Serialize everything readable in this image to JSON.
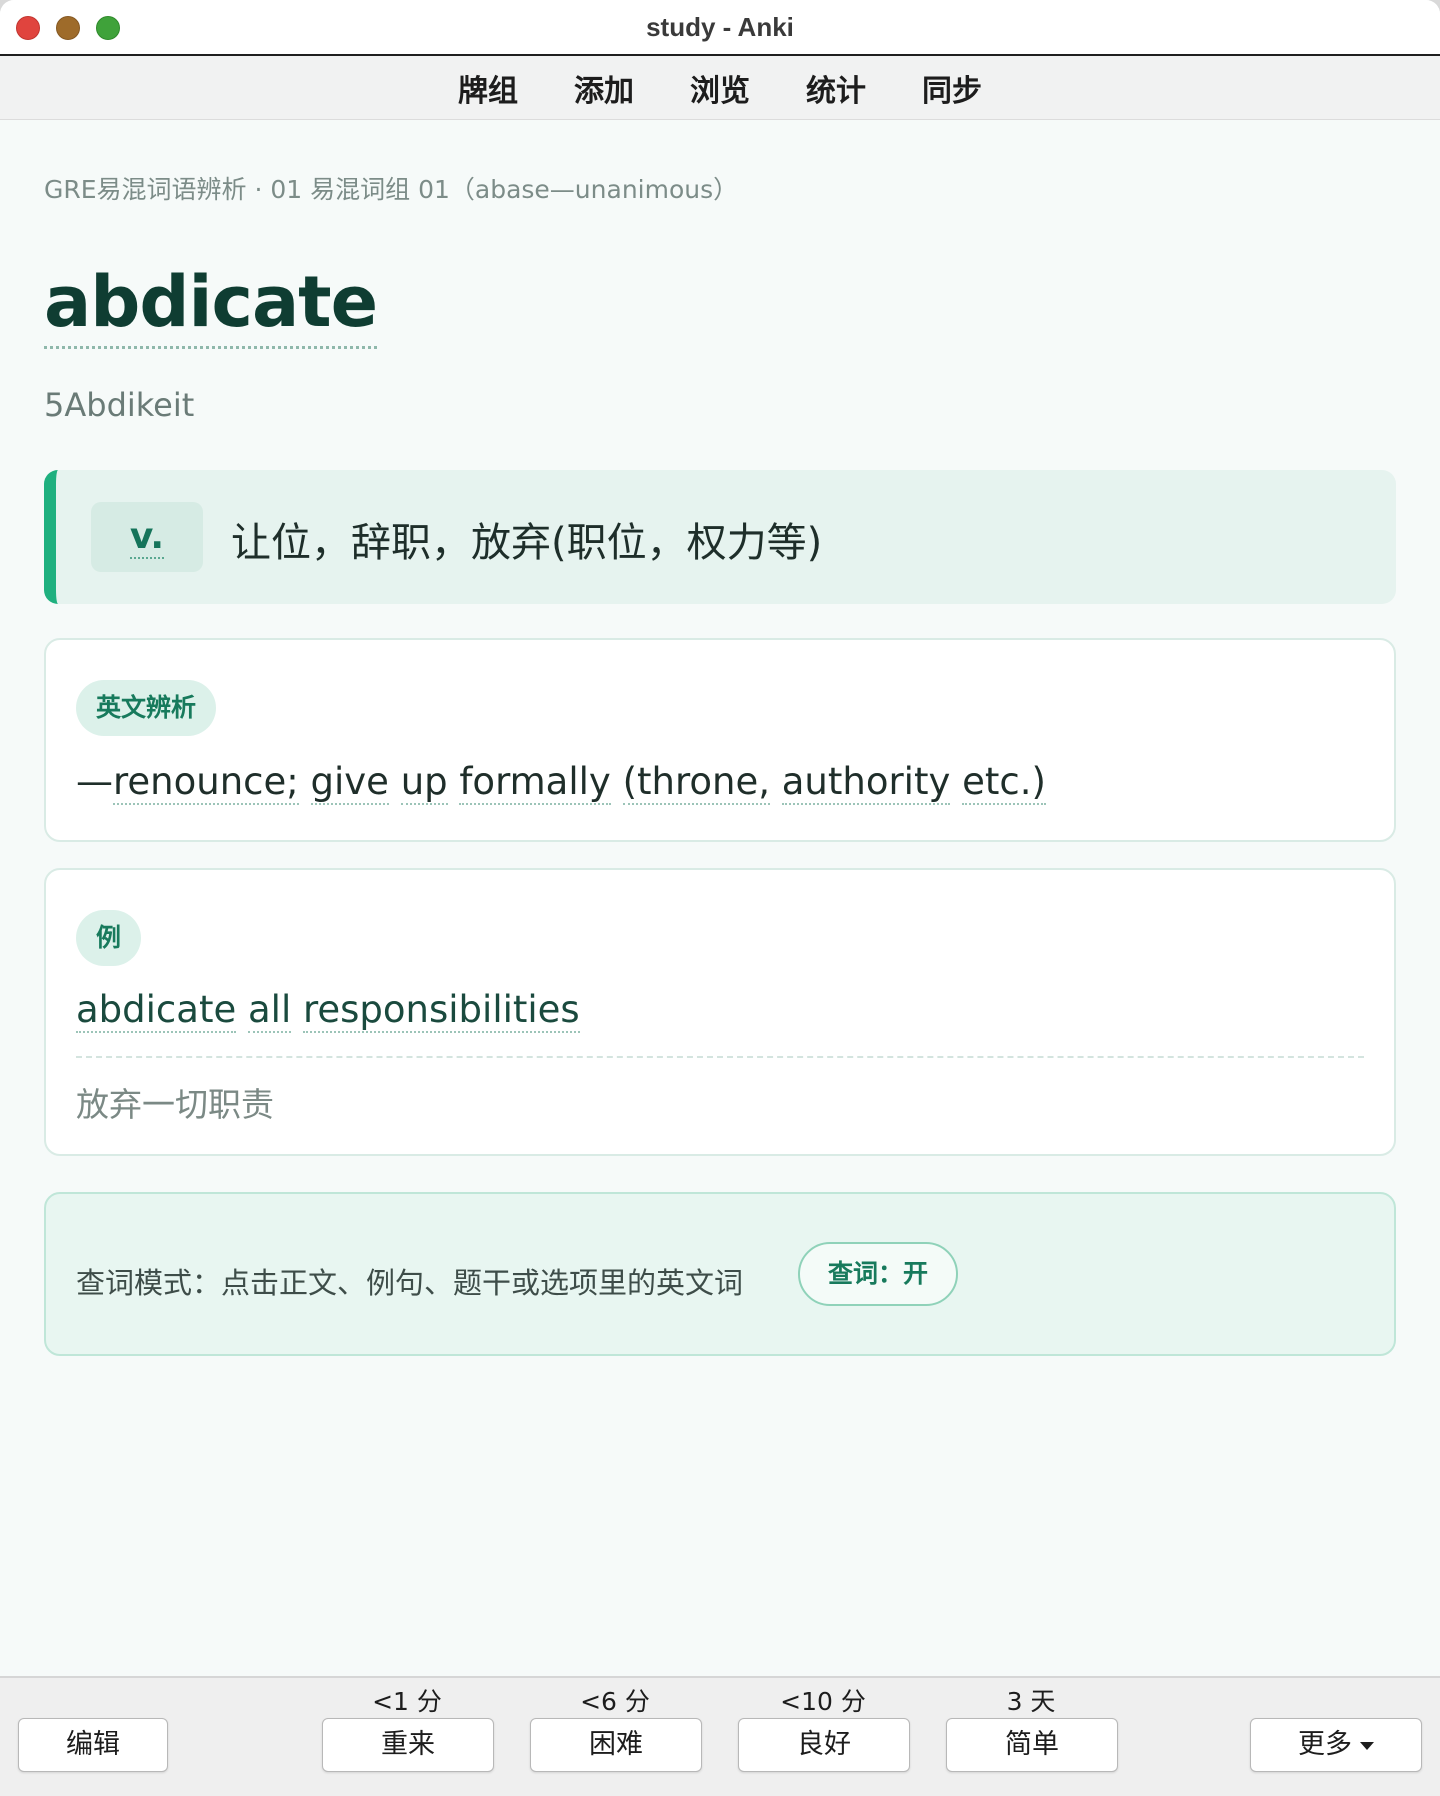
{
  "window": {
    "title": "study - Anki"
  },
  "toolbar": {
    "items": [
      {
        "label": "牌组"
      },
      {
        "label": "添加"
      },
      {
        "label": "浏览"
      },
      {
        "label": "统计"
      },
      {
        "label": "同步"
      }
    ]
  },
  "card": {
    "deck_path": "GRE易混词语辨析 · 01 易混词组 01（abase—unanimous）",
    "headword": "abdicate",
    "phonetic": "5Abdikeit",
    "part_of_speech": "v.",
    "meaning": "让位，辞职，放弃(职位，权力等)",
    "analysis": {
      "tag": "英文辨析",
      "dash": "—",
      "words": [
        "renounce;",
        "give",
        "up",
        "formally",
        "(throne,",
        "authority",
        "etc.)"
      ]
    },
    "example": {
      "tag": "例",
      "sentence_words": [
        "abdicate",
        "all",
        "responsibilities"
      ],
      "translation": "放弃一切职责"
    },
    "lookup": {
      "description": "查词模式：点击正文、例句、题干或选项里的英文词",
      "toggle_label": "查词：开"
    }
  },
  "bottombar": {
    "edit_label": "编辑",
    "answers": [
      {
        "interval": "<1 分",
        "label": "重来"
      },
      {
        "interval": "<6 分",
        "label": "困难"
      },
      {
        "interval": "<10 分",
        "label": "良好"
      },
      {
        "interval": "3 天",
        "label": "简单"
      }
    ],
    "more_label": "更多"
  },
  "colors": {
    "accent": "#1fb07f",
    "headword": "#0f3d32",
    "tag_text": "#177a5c",
    "background": "#f6faf9"
  }
}
